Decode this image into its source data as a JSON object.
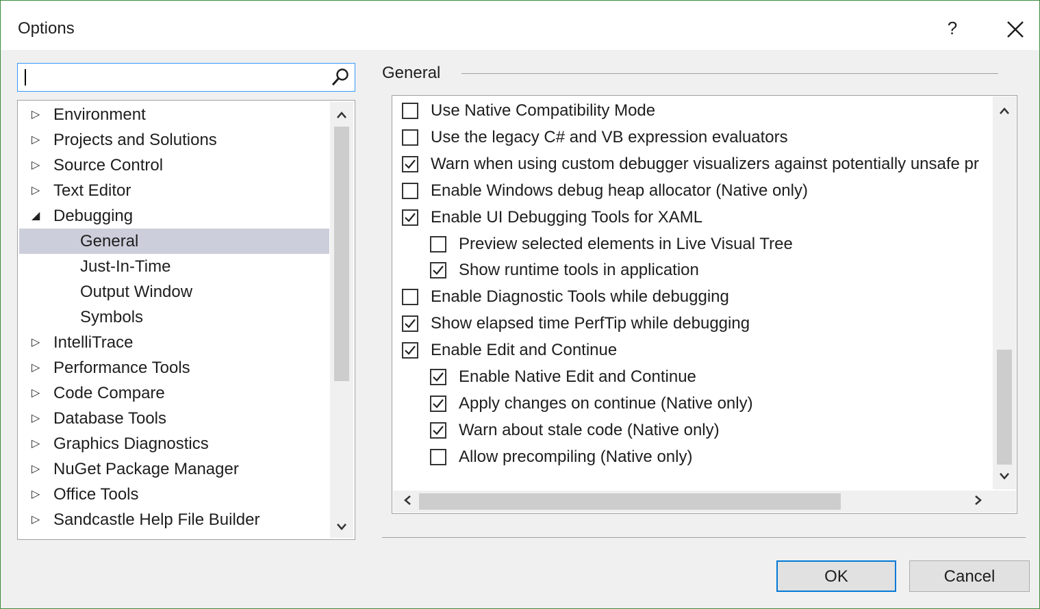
{
  "window": {
    "title": "Options",
    "help_glyph": "?",
    "close_glyph": "✕"
  },
  "search": {
    "value": "",
    "placeholder": ""
  },
  "tree": {
    "items": [
      {
        "label": "Environment",
        "arrow": "▷"
      },
      {
        "label": "Projects and Solutions",
        "arrow": "▷"
      },
      {
        "label": "Source Control",
        "arrow": "▷"
      },
      {
        "label": "Text Editor",
        "arrow": "▷"
      },
      {
        "label": "Debugging",
        "arrow": "◢"
      },
      {
        "label": "General",
        "arrow": ""
      },
      {
        "label": "Just-In-Time",
        "arrow": ""
      },
      {
        "label": "Output Window",
        "arrow": ""
      },
      {
        "label": "Symbols",
        "arrow": ""
      },
      {
        "label": "IntelliTrace",
        "arrow": "▷"
      },
      {
        "label": "Performance Tools",
        "arrow": "▷"
      },
      {
        "label": "Code Compare",
        "arrow": "▷"
      },
      {
        "label": "Database Tools",
        "arrow": "▷"
      },
      {
        "label": "Graphics Diagnostics",
        "arrow": "▷"
      },
      {
        "label": "NuGet Package Manager",
        "arrow": "▷"
      },
      {
        "label": "Office Tools",
        "arrow": "▷"
      },
      {
        "label": "Sandcastle Help File Builder",
        "arrow": "▷"
      }
    ],
    "selected": "General",
    "scroll_up": "⌃",
    "scroll_down": "⌄"
  },
  "section": {
    "title": "General"
  },
  "options": [
    {
      "label": "Use Native Compatibility Mode",
      "checked": false
    },
    {
      "label": "Use the legacy C# and VB expression evaluators",
      "checked": false
    },
    {
      "label": "Warn when using custom debugger visualizers against potentially unsafe pr",
      "checked": true
    },
    {
      "label": "Enable Windows debug heap allocator (Native only)",
      "checked": false
    },
    {
      "label": "Enable UI Debugging Tools for XAML",
      "checked": true
    },
    {
      "label": "Preview selected elements in Live Visual Tree",
      "checked": false
    },
    {
      "label": "Show runtime tools in application",
      "checked": true
    },
    {
      "label": "Enable Diagnostic Tools while debugging",
      "checked": false
    },
    {
      "label": "Show elapsed time PerfTip while debugging",
      "checked": true
    },
    {
      "label": "Enable Edit and Continue",
      "checked": true
    },
    {
      "label": "Enable Native Edit and Continue",
      "checked": true
    },
    {
      "label": "Apply changes on continue (Native only)",
      "checked": true
    },
    {
      "label": "Warn about stale code (Native only)",
      "checked": true
    },
    {
      "label": "Allow precompiling (Native only)",
      "checked": false
    }
  ],
  "scroll": {
    "up": "⌃",
    "down": "⌄",
    "left": "‹",
    "right": "›"
  },
  "buttons": {
    "ok": "OK",
    "cancel": "Cancel"
  },
  "colors": {
    "accent": "#0078d7",
    "selection": "#cccedb",
    "window_border": "#3c8b3c"
  }
}
